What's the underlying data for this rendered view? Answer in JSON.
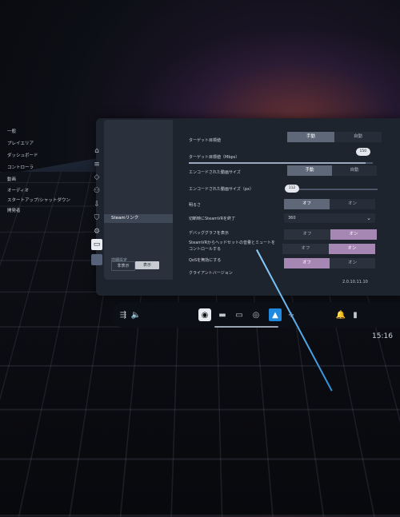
{
  "side_rail": {
    "icons": [
      "home-icon",
      "stack-icon",
      "tag-icon",
      "people-icon",
      "download-icon",
      "shield-icon",
      "gear-icon",
      "vr-headset-icon"
    ]
  },
  "menu": {
    "items": [
      {
        "label": "一般"
      },
      {
        "label": "プレイエリア"
      },
      {
        "label": "ダッシュボード"
      },
      {
        "label": "コントローラ"
      },
      {
        "label": "動画"
      },
      {
        "label": "オーディオ"
      },
      {
        "label": "スタートアップ/シャットダウン"
      },
      {
        "label": "開発者"
      },
      {
        "label": "Steamリンク"
      }
    ],
    "selected_index": 8,
    "performance": {
      "label": "詳細設定",
      "low": "非表示",
      "high": "表示"
    }
  },
  "settings": {
    "target_bitrate": {
      "label": "ターゲット目標値",
      "options": [
        "手動",
        "自動"
      ],
      "selected": "手動"
    },
    "target_bitrate_value": {
      "label": "ターゲット目標値（Mbps）",
      "value": "150",
      "fraction": 0.96
    },
    "encode_size": {
      "label": "エンコードされた動画サイズ",
      "options": [
        "手動",
        "自動"
      ],
      "selected": "手動"
    },
    "encode_size_value": {
      "label": "エンコードされた動画サイズ（px）",
      "value": "112",
      "fraction": 0.0
    },
    "hdr": {
      "label": "明るさ",
      "options": [
        "オフ",
        "オン"
      ],
      "selected": "オフ"
    },
    "sleep_timeout": {
      "label": "切断時にSteamVRを終了",
      "value": "360"
    },
    "debug_graph": {
      "label": "デバッググラフを表示",
      "options": [
        "オフ",
        "オン"
      ],
      "selected": "オン"
    },
    "headset_audio": {
      "label": "SteamVRからヘッドセットの音量とミュートをコントロールする",
      "options": [
        "オフ",
        "オン"
      ],
      "selected": "オン"
    },
    "qos": {
      "label": "QoSを無効にする",
      "options": [
        "オフ",
        "オン"
      ],
      "selected": "オフ"
    },
    "client_version": {
      "label": "クライアントバージョン",
      "value": "2.0.10.11.10"
    }
  },
  "taskbar": {
    "left_icons": [
      "library-icon",
      "volume-icon"
    ],
    "apps": [
      "steam-icon",
      "desktop-icon",
      "monitor-icon",
      "browser-icon",
      "steamvr-icon"
    ],
    "add_label": "+",
    "tray_icons": [
      "notification-icon",
      "battery-icon"
    ],
    "clock": "15:16"
  }
}
